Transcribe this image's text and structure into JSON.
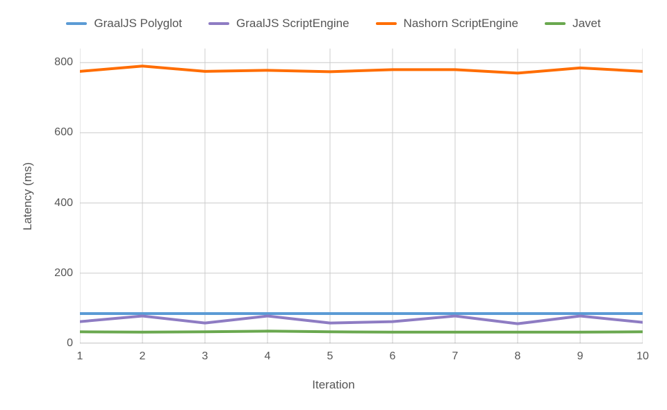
{
  "chart_data": {
    "type": "line",
    "title": "",
    "xlabel": "Iteration",
    "ylabel": "Latency (ms)",
    "x": [
      1,
      2,
      3,
      4,
      5,
      6,
      7,
      8,
      9,
      10
    ],
    "ylim": [
      0,
      840
    ],
    "yticks": [
      0,
      200,
      400,
      600,
      800
    ],
    "xlim": [
      1,
      10
    ],
    "series": [
      {
        "name": "GraalJS Polyglot",
        "color": "#5b9bd5",
        "values": [
          85,
          85,
          85,
          85,
          85,
          85,
          85,
          85,
          85,
          85
        ]
      },
      {
        "name": "GraalJS ScriptEngine",
        "color": "#8e7cc3",
        "values": [
          62,
          78,
          58,
          78,
          58,
          62,
          78,
          56,
          78,
          60
        ]
      },
      {
        "name": "Nashorn ScriptEngine",
        "color": "#ff6d01",
        "values": [
          775,
          790,
          775,
          778,
          774,
          780,
          780,
          770,
          785,
          775
        ]
      },
      {
        "name": "Javet",
        "color": "#6aa84f",
        "values": [
          33,
          32,
          33,
          35,
          33,
          32,
          32,
          32,
          32,
          33
        ]
      }
    ]
  }
}
